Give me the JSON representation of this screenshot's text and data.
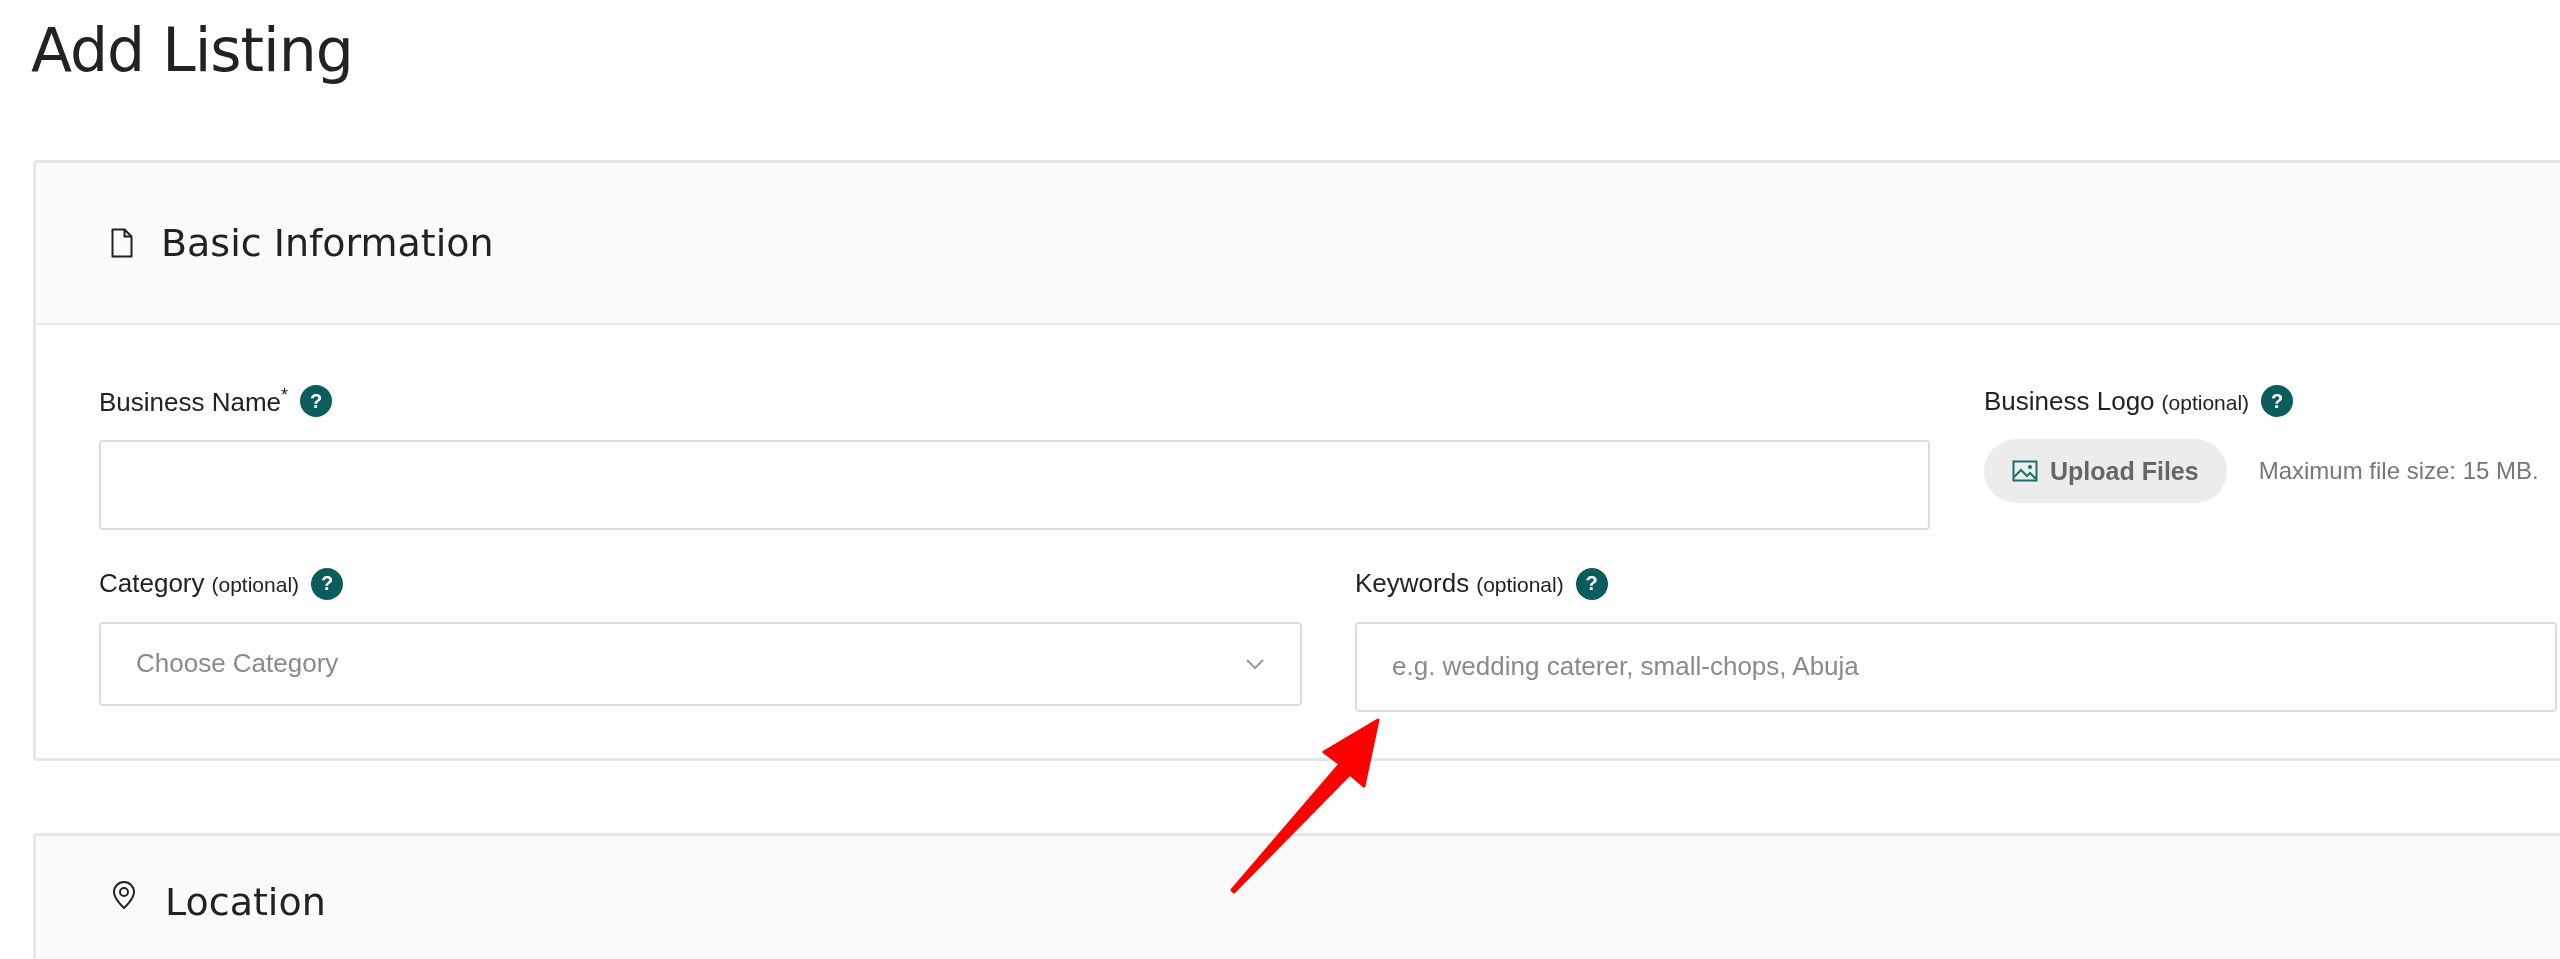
{
  "page_title": "Add Listing",
  "sections": [
    {
      "title": "Basic Information",
      "rows": [
        [
          {
            "kind": "text",
            "label": "Business Name",
            "required_mark": "*",
            "help": "?"
          },
          {
            "kind": "upload",
            "label": "Business Logo",
            "note": "(optional)",
            "help": "?",
            "button": "Upload Files",
            "hint": "Maximum file size: 15 MB."
          }
        ],
        [
          {
            "kind": "select",
            "label": "Category",
            "note": "(optional)",
            "help": "?",
            "placeholder": "Choose Category"
          },
          {
            "kind": "text",
            "label": "Keywords",
            "note": "(optional)",
            "help": "?",
            "placeholder": "e.g. wedding caterer, small-chops, Abuja"
          }
        ]
      ]
    },
    {
      "title": "Location"
    }
  ]
}
